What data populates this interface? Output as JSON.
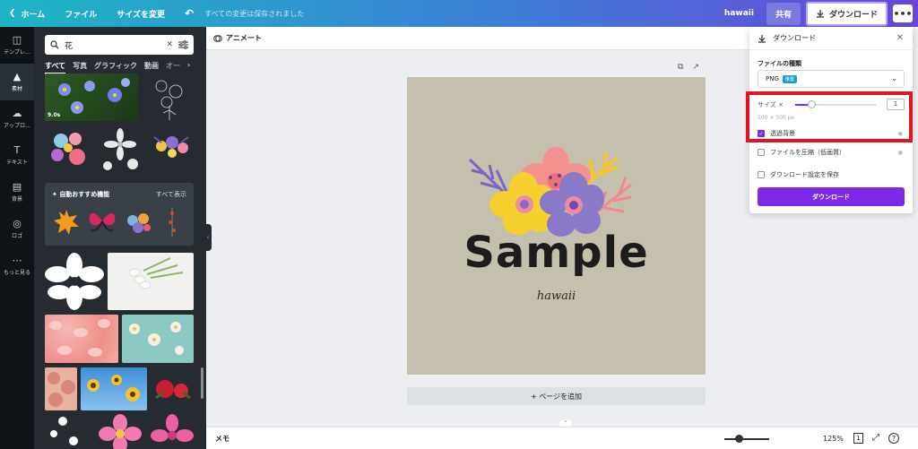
{
  "topbar": {
    "home": "ホーム",
    "file": "ファイル",
    "resize": "サイズを変更",
    "saved_status": "すべての変更は保存されました",
    "title": "hawaii",
    "share": "共有",
    "download": "ダウンロード",
    "more": "•••"
  },
  "rail": {
    "items": [
      {
        "label": "テンプレ…",
        "icon": "template-icon"
      },
      {
        "label": "素材",
        "icon": "elements-icon"
      },
      {
        "label": "アップロ…",
        "icon": "upload-icon"
      },
      {
        "label": "テキスト",
        "icon": "text-icon"
      },
      {
        "label": "背景",
        "icon": "background-icon"
      },
      {
        "label": "ロゴ",
        "icon": "logo-icon"
      },
      {
        "label": "もっと見る",
        "icon": "more-icon"
      }
    ]
  },
  "panel": {
    "search_value": "花",
    "tabs": [
      "すべて",
      "写真",
      "グラフィック",
      "動画",
      "オー"
    ],
    "video_duration": "9.0s",
    "auto_title": "自動おすすめ機能",
    "auto_all": "すべて表示"
  },
  "editor": {
    "animate": "アニメート",
    "design_main": "Sample",
    "design_sub": "hawaii",
    "add_page": "+ ページを追加"
  },
  "bottombar": {
    "memo": "メモ",
    "zoom": "125%",
    "page_count": "1",
    "zoom_level": 0.32
  },
  "download_panel": {
    "header": "ダウンロード",
    "file_type_label": "ファイルの種類",
    "file_type": "PNG",
    "file_type_badge": "推奨",
    "size_label": "サイズ ×",
    "size_value": "1",
    "size_level": 0.2,
    "dimensions": "500 × 500 px",
    "transparent_bg": "透過背景",
    "transparent_checked": true,
    "compress": "ファイルを圧縮（低画質）",
    "compress_checked": false,
    "save_settings": "ダウンロード設定を保存",
    "save_checked": false,
    "download_button": "ダウンロード"
  },
  "colors": {
    "accent": "#7d2ae8",
    "highlight": "#e3141f",
    "canvas": "#c5bfae"
  }
}
